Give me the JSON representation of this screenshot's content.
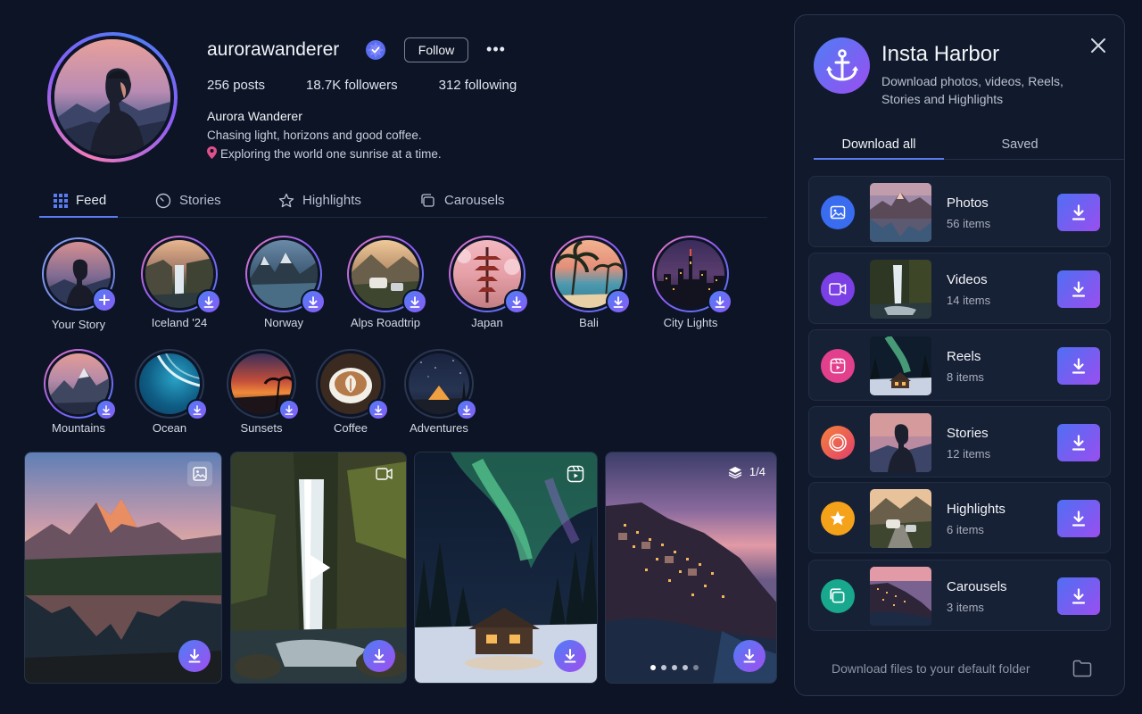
{
  "profile": {
    "username": "aurorawanderer",
    "follow_label": "Follow",
    "more_label": "•••",
    "posts": "256 posts",
    "followers": "18.7K followers",
    "following": "312 following",
    "full_name": "Aurora Wanderer",
    "bio_line1": "Chasing light, horizons and good coffee.",
    "bio_line2": "Exploring the world one sunrise at a time.",
    "icons": {
      "verified": "verified-badge-icon",
      "more": "more-options-icon",
      "pin": "map-pin-icon"
    }
  },
  "tabs": [
    {
      "label": "Feed",
      "icon": "grid-icon",
      "active": true
    },
    {
      "label": "Stories",
      "icon": "clock-icon",
      "active": false
    },
    {
      "label": "Highlights",
      "icon": "star-icon",
      "active": false
    },
    {
      "label": "Carousels",
      "icon": "layers-icon",
      "active": false
    }
  ],
  "highlights_row1": [
    {
      "label": "Your Story",
      "badge": "plus"
    },
    {
      "label": "Iceland '24",
      "badge": "download"
    },
    {
      "label": "Norway",
      "badge": "download"
    },
    {
      "label": "Alps Roadtrip",
      "badge": "download"
    },
    {
      "label": "Japan",
      "badge": "download"
    },
    {
      "label": "Bali",
      "badge": "download"
    },
    {
      "label": "City Lights",
      "badge": "download"
    }
  ],
  "highlights_row2": [
    {
      "label": "Mountains",
      "badge": "download"
    },
    {
      "label": "Ocean",
      "badge": "download"
    },
    {
      "label": "Sunsets",
      "badge": "download"
    },
    {
      "label": "Coffee",
      "badge": "download"
    },
    {
      "label": "Adventures",
      "badge": "download"
    }
  ],
  "posts": [
    {
      "type": "photo",
      "icon": "image-icon"
    },
    {
      "type": "video",
      "icon": "video-camera-icon"
    },
    {
      "type": "reel",
      "icon": "reel-icon"
    },
    {
      "type": "carousel",
      "icon": "layers-icon",
      "counter": "1/4",
      "dots": 5,
      "active_dot": 1
    }
  ],
  "panel": {
    "title": "Insta Harbor",
    "subtitle": "Download photos, videos, Reels, Stories and Highlights",
    "tab_download_all": "Download all",
    "tab_saved": "Saved",
    "items": [
      {
        "name": "Photos",
        "count": "56 items",
        "icon": "image-icon",
        "color": "#3a6cf0"
      },
      {
        "name": "Videos",
        "count": "14 items",
        "icon": "video-camera-icon",
        "color": "#7b3fe6"
      },
      {
        "name": "Reels",
        "count": "8 items",
        "icon": "reel-icon",
        "color": "#e23f8c"
      },
      {
        "name": "Stories",
        "count": "12 items",
        "icon": "story-ring-icon",
        "color": "#f0553a"
      },
      {
        "name": "Highlights",
        "count": "6 items",
        "icon": "star-icon",
        "color": "#f5a21b"
      },
      {
        "name": "Carousels",
        "count": "3 items",
        "icon": "layers-icon",
        "color": "#17a88e"
      }
    ],
    "footer": "Download files to your default folder"
  },
  "colors": {
    "background": "#0c1426",
    "panel": "#111a2c",
    "accent_blue": "#4f7df5",
    "accent_purple": "#9a4ef0"
  }
}
